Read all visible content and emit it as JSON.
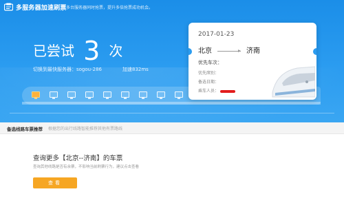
{
  "app": {
    "title": "多服务器加速刷票",
    "subtitle": "多台服务器同时抢票，提升多倍抢票成功机会。"
  },
  "status": {
    "tried_prefix": "已尝试",
    "tried_count": "3",
    "tried_suffix": "次",
    "server_label": "切换到最快服务器：sogou-286",
    "speed_label": "加速832ms"
  },
  "ticket": {
    "date": "2017-01-23",
    "from": "北京",
    "to": "济南",
    "priority_train_label": "优先车次：",
    "priority_seat_label": "优先席别：",
    "alternate_date_label": "备选日期：",
    "passenger_label": "乘车人员：",
    "redaction_color": "#e21d1d"
  },
  "train": {
    "window_count": 10,
    "active_window_index": 0
  },
  "section": {
    "title": "备选线路车票推荐",
    "hint": "根据您的出行线路智能推荐其他有票路线"
  },
  "query": {
    "title": "查询更多【北京--济南】的车票",
    "desc": "查询其他线路是否有余票，不影响当前刷票行为，建议点击查看",
    "button_label": "查看"
  },
  "colors": {
    "hero_blue": "#2b9cf0",
    "accent_orange": "#f6a623"
  }
}
